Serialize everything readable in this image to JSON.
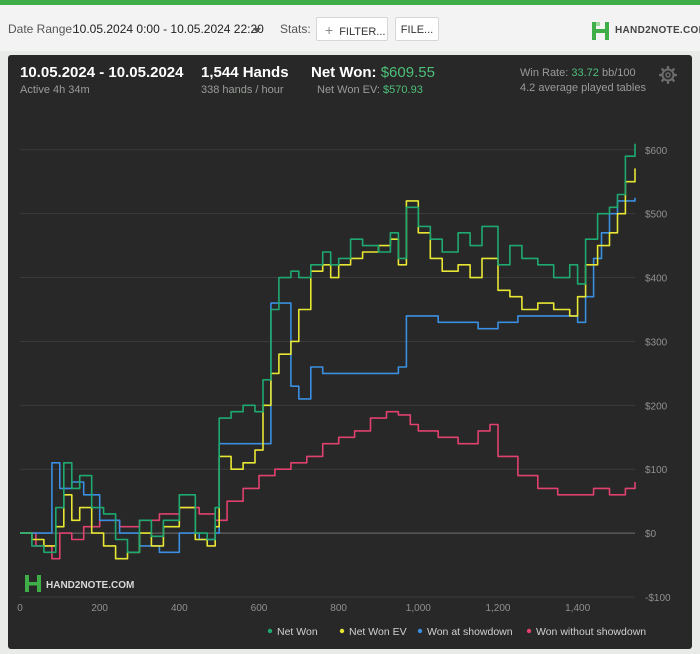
{
  "toolbar": {
    "date_range_label": "Date Range:",
    "date_range_value": "10.05.2024 0:00 - 10.05.2024 22:20",
    "stats_label": "Stats:",
    "filter_button": "FILTER...",
    "file_button": "FILE...",
    "logo_text": "HAND2NOTE.COM"
  },
  "summary": {
    "date_range": "10.05.2024 - 10.05.2024",
    "active": "Active 4h 34m",
    "hands": "1,544 Hands",
    "hands_per_hour": "338 hands / hour",
    "net_won_label": "Net Won:",
    "net_won_value": "$609.55",
    "net_won_ev_label": "Net Won  EV:",
    "net_won_ev_value": "$570.93",
    "win_rate_label": "Win Rate:",
    "win_rate_value": "33.72",
    "win_rate_unit": "bb/100",
    "tables": "4.2 average played tables"
  },
  "watermark": "HAND2NOTE.COM",
  "colors": {
    "net_won": "#1fa971",
    "net_won_ev": "#e8e635",
    "showdown": "#3b8ee0",
    "no_showdown": "#e0416f",
    "accent": "#4fbf7a"
  },
  "chart_data": {
    "type": "line",
    "xlim": [
      0,
      1544
    ],
    "ylim": [
      -100,
      620
    ],
    "x_ticks": [
      0,
      200,
      400,
      600,
      800,
      1000,
      1200,
      1400
    ],
    "x_tick_labels": [
      "0",
      "200",
      "400",
      "600",
      "800",
      "1,000",
      "1,200",
      "1,400"
    ],
    "y_ticks": [
      -100,
      0,
      100,
      200,
      300,
      400,
      500,
      600
    ],
    "y_tick_labels": [
      "-$100",
      "$0",
      "$100",
      "$200",
      "$300",
      "$400",
      "$500",
      "$600"
    ],
    "grid": true,
    "legend_position": "bottom-right",
    "series": [
      {
        "name": "Net Won",
        "color": "#1fa971",
        "x": [
          0,
          30,
          60,
          90,
          110,
          130,
          150,
          180,
          210,
          240,
          270,
          300,
          330,
          360,
          400,
          440,
          470,
          490,
          500,
          530,
          560,
          590,
          610,
          630,
          650,
          680,
          700,
          730,
          760,
          780,
          800,
          830,
          860,
          900,
          930,
          950,
          970,
          1000,
          1030,
          1060,
          1100,
          1130,
          1160,
          1200,
          1230,
          1260,
          1300,
          1340,
          1380,
          1400,
          1420,
          1450,
          1480,
          1500,
          1520,
          1544
        ],
        "y": [
          0,
          -20,
          -30,
          40,
          110,
          70,
          90,
          40,
          30,
          -10,
          -30,
          20,
          -5,
          20,
          60,
          0,
          -10,
          40,
          180,
          190,
          200,
          190,
          240,
          350,
          400,
          410,
          400,
          420,
          440,
          420,
          430,
          460,
          450,
          440,
          470,
          430,
          510,
          480,
          460,
          440,
          470,
          450,
          480,
          420,
          450,
          430,
          420,
          400,
          420,
          390,
          460,
          500,
          510,
          530,
          590,
          609.55
        ]
      },
      {
        "name": "Net Won  EV",
        "color": "#e8e635",
        "x": [
          0,
          30,
          60,
          90,
          110,
          130,
          150,
          180,
          210,
          240,
          270,
          300,
          330,
          360,
          400,
          440,
          470,
          490,
          500,
          530,
          560,
          590,
          610,
          630,
          650,
          680,
          700,
          730,
          760,
          780,
          800,
          830,
          860,
          900,
          930,
          950,
          970,
          1000,
          1030,
          1060,
          1100,
          1130,
          1160,
          1200,
          1230,
          1260,
          1300,
          1340,
          1380,
          1400,
          1420,
          1450,
          1480,
          1500,
          1520,
          1544
        ],
        "y": [
          0,
          -10,
          -20,
          10,
          60,
          20,
          40,
          0,
          -20,
          -40,
          -30,
          0,
          -20,
          10,
          40,
          -10,
          -20,
          10,
          120,
          100,
          110,
          130,
          200,
          250,
          280,
          300,
          350,
          410,
          420,
          400,
          420,
          430,
          440,
          450,
          460,
          420,
          520,
          470,
          430,
          410,
          420,
          400,
          430,
          380,
          370,
          350,
          360,
          350,
          340,
          370,
          420,
          450,
          470,
          500,
          550,
          570.93
        ]
      },
      {
        "name": "Won at showdown",
        "color": "#3b8ee0",
        "x": [
          0,
          50,
          80,
          100,
          130,
          160,
          200,
          250,
          300,
          350,
          400,
          450,
          490,
          500,
          560,
          610,
          630,
          680,
          700,
          730,
          760,
          800,
          850,
          900,
          950,
          970,
          1000,
          1050,
          1100,
          1150,
          1200,
          1250,
          1300,
          1350,
          1400,
          1420,
          1440,
          1460,
          1480,
          1500,
          1544
        ],
        "y": [
          0,
          0,
          110,
          70,
          80,
          60,
          20,
          0,
          -20,
          -30,
          0,
          -10,
          0,
          140,
          140,
          140,
          360,
          230,
          210,
          260,
          250,
          250,
          250,
          250,
          260,
          340,
          340,
          330,
          330,
          320,
          330,
          340,
          340,
          340,
          330,
          370,
          430,
          470,
          500,
          520,
          525
        ]
      },
      {
        "name": "Won without showdown",
        "color": "#e0416f",
        "x": [
          0,
          40,
          80,
          100,
          130,
          160,
          200,
          250,
          300,
          350,
          400,
          450,
          490,
          520,
          560,
          600,
          640,
          680,
          720,
          760,
          800,
          840,
          880,
          920,
          950,
          980,
          1000,
          1050,
          1100,
          1150,
          1180,
          1200,
          1250,
          1300,
          1350,
          1400,
          1440,
          1480,
          1520,
          1544
        ],
        "y": [
          0,
          -20,
          -40,
          0,
          -10,
          10,
          20,
          10,
          20,
          30,
          40,
          30,
          20,
          50,
          70,
          90,
          100,
          110,
          120,
          140,
          150,
          160,
          180,
          190,
          185,
          170,
          160,
          150,
          140,
          160,
          170,
          120,
          90,
          70,
          60,
          60,
          70,
          60,
          70,
          80
        ]
      }
    ]
  }
}
